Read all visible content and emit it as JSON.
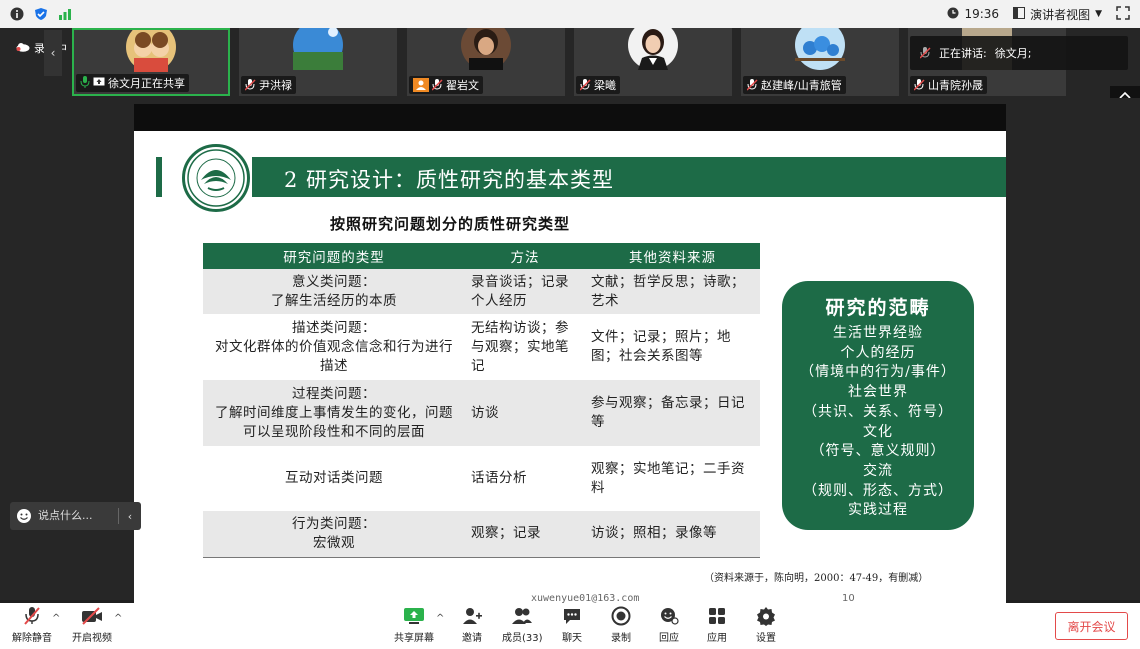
{
  "topbar": {
    "time": "19:36",
    "view_label": "演讲者视图"
  },
  "recording": {
    "label": "录制中"
  },
  "participants": [
    {
      "name": "徐文月正在共享"
    },
    {
      "name": "尹洪禄"
    },
    {
      "name": "翟岩文"
    },
    {
      "name": "梁曦"
    },
    {
      "name": "赵建峰/山青旅管"
    },
    {
      "name": "山青院孙晟"
    }
  ],
  "speaking": {
    "label": "正在讲话:",
    "name": "徐文月;"
  },
  "slide": {
    "title": "2 研究设计：质性研究的基本类型",
    "subtitle": "按照研究问题划分的质性研究类型",
    "table_headers": [
      "研究问题的类型",
      "方法",
      "其他资料来源"
    ],
    "rows": [
      {
        "c1a": "意义类问题：",
        "c1b": "了解生活经历的本质",
        "c2": "录音谈话；记录个人经历",
        "c3": "文献；哲学反思；诗歌；艺术"
      },
      {
        "c1a": "描述类问题：",
        "c1b": "对文化群体的价值观念信念和行为进行描述",
        "c2": "无结构访谈；参与观察；实地笔记",
        "c3": "文件；记录；照片；地图；社会关系图等"
      },
      {
        "c1a": "过程类问题：",
        "c1b": "了解时间维度上事情发生的变化，问题可以呈现阶段性和不同的层面",
        "c2": "访谈",
        "c3": "参与观察；备忘录；日记等"
      },
      {
        "c1a": "互动对话类问题",
        "c1b": "",
        "c2": "话语分析",
        "c3": "观察；实地笔记；二手资料"
      },
      {
        "c1a": "行为类问题：",
        "c1b": "宏微观",
        "c2": "观察；记录",
        "c3": "访谈；照相；录像等"
      }
    ],
    "scope": {
      "title": "研究的范畴",
      "lines": [
        "生活世界经验",
        "个人的经历",
        "（情境中的行为/事件）",
        "社会世界",
        "（共识、关系、符号）",
        "文化",
        "（符号、意义规则）",
        "交流",
        "（规则、形态、方式）",
        "实践过程"
      ]
    },
    "source": "（资料来源于，陈向明，2000：47-49，有删减）",
    "email": "xuwenyue01@163.com",
    "page_number": "10"
  },
  "chat": {
    "placeholder": "说点什么..."
  },
  "toolbar": {
    "unmute": "解除静音",
    "start_video": "开启视频",
    "share_screen": "共享屏幕",
    "invite": "邀请",
    "members": "成员(33)",
    "chat": "聊天",
    "record": "录制",
    "reactions": "回应",
    "apps": "应用",
    "settings": "设置",
    "leave": "离开会议"
  },
  "colors": {
    "accent_green": "#1d6b47",
    "leave_red": "#e34a4a"
  }
}
